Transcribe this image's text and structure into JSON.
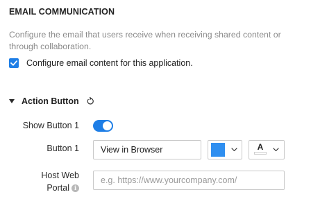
{
  "section": {
    "title": "EMAIL COMMUNICATION",
    "description": "Configure the email that users receive when receiving shared content or through collaboration."
  },
  "configure_checkbox": {
    "label": "Configure email content for this application.",
    "checked": true,
    "color": "#1e7ee6"
  },
  "action_button": {
    "heading": "Action Button",
    "caret_icon": "caret-down-icon",
    "reset_icon": "reset-icon"
  },
  "show_button": {
    "label": "Show Button 1",
    "enabled": true
  },
  "button1": {
    "label": "Button 1",
    "value": "View in Browser",
    "color": "#2f8ff0",
    "font_icon": "font-color-icon",
    "font_glyph": "A"
  },
  "host_portal": {
    "label_line1": "Host Web",
    "label_line2": "Portal",
    "placeholder": "e.g. https://www.yourcompany.com/",
    "info_icon": "info-icon"
  }
}
